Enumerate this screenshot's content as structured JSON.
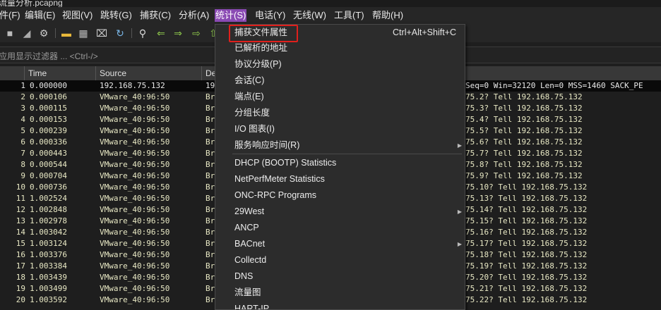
{
  "window": {
    "title": "流量分析.pcapng"
  },
  "menubar": {
    "items": [
      {
        "label": "件(F)",
        "name": "menu-file"
      },
      {
        "label": "编辑(E)",
        "name": "menu-edit"
      },
      {
        "label": "视图(V)",
        "name": "menu-view"
      },
      {
        "label": "跳转(G)",
        "name": "menu-go"
      },
      {
        "label": "捕获(C)",
        "name": "menu-capture"
      },
      {
        "label": "分析(A)",
        "name": "menu-analyze"
      },
      {
        "label": "统计(S)",
        "name": "menu-statistics",
        "active": true
      },
      {
        "label": "电话(Y)",
        "name": "menu-telephony"
      },
      {
        "label": "无线(W)",
        "name": "menu-wireless"
      },
      {
        "label": "工具(T)",
        "name": "menu-tools"
      },
      {
        "label": "帮助(H)",
        "name": "menu-help"
      }
    ]
  },
  "toolbar": {
    "icons": [
      "stop-capture-icon",
      "shark-fin-icon",
      "options-gear-icon",
      "open-folder-icon",
      "save-file-icon",
      "close-file-icon",
      "reload-icon",
      "find-packet-icon",
      "go-back-icon",
      "go-forward-icon",
      "go-to-packet-icon"
    ]
  },
  "filter": {
    "placeholder": "应用显示过滤器 ... <Ctrl-/>"
  },
  "columns": [
    "Time",
    "Source",
    "De"
  ],
  "packets": [
    {
      "no": "1",
      "time": "0.000000",
      "src": "192.168.75.132",
      "dst": "19",
      "info": "Seq=0 Win=32120 Len=0 MSS=1460 SACK_PE"
    },
    {
      "no": "2",
      "time": "0.000106",
      "src": "VMware_40:96:50",
      "dst": "Br",
      "info": "75.2? Tell 192.168.75.132"
    },
    {
      "no": "3",
      "time": "0.000115",
      "src": "VMware_40:96:50",
      "dst": "Br",
      "info": "75.3? Tell 192.168.75.132"
    },
    {
      "no": "4",
      "time": "0.000153",
      "src": "VMware_40:96:50",
      "dst": "Br",
      "info": "75.4? Tell 192.168.75.132"
    },
    {
      "no": "5",
      "time": "0.000239",
      "src": "VMware_40:96:50",
      "dst": "Br",
      "info": "75.5? Tell 192.168.75.132"
    },
    {
      "no": "6",
      "time": "0.000336",
      "src": "VMware_40:96:50",
      "dst": "Br",
      "info": "75.6? Tell 192.168.75.132"
    },
    {
      "no": "7",
      "time": "0.000443",
      "src": "VMware_40:96:50",
      "dst": "Br",
      "info": "75.7? Tell 192.168.75.132"
    },
    {
      "no": "8",
      "time": "0.000544",
      "src": "VMware_40:96:50",
      "dst": "Br",
      "info": "75.8? Tell 192.168.75.132"
    },
    {
      "no": "9",
      "time": "0.000704",
      "src": "VMware_40:96:50",
      "dst": "Br",
      "info": "75.9? Tell 192.168.75.132"
    },
    {
      "no": "10",
      "time": "0.000736",
      "src": "VMware_40:96:50",
      "dst": "Br",
      "info": "75.10? Tell 192.168.75.132"
    },
    {
      "no": "11",
      "time": "1.002524",
      "src": "VMware_40:96:50",
      "dst": "Br",
      "info": "75.13? Tell 192.168.75.132"
    },
    {
      "no": "12",
      "time": "1.002848",
      "src": "VMware_40:96:50",
      "dst": "Br",
      "info": "75.14? Tell 192.168.75.132"
    },
    {
      "no": "13",
      "time": "1.002978",
      "src": "VMware_40:96:50",
      "dst": "Br",
      "info": "75.15? Tell 192.168.75.132"
    },
    {
      "no": "14",
      "time": "1.003042",
      "src": "VMware_40:96:50",
      "dst": "Br",
      "info": "75.16? Tell 192.168.75.132"
    },
    {
      "no": "15",
      "time": "1.003124",
      "src": "VMware_40:96:50",
      "dst": "Br",
      "info": "75.17? Tell 192.168.75.132"
    },
    {
      "no": "16",
      "time": "1.003376",
      "src": "VMware_40:96:50",
      "dst": "Br",
      "info": "75.18? Tell 192.168.75.132"
    },
    {
      "no": "17",
      "time": "1.003384",
      "src": "VMware_40:96:50",
      "dst": "Br",
      "info": "75.19? Tell 192.168.75.132"
    },
    {
      "no": "18",
      "time": "1.003439",
      "src": "VMware_40:96:50",
      "dst": "Br",
      "info": "75.20? Tell 192.168.75.132"
    },
    {
      "no": "19",
      "time": "1.003499",
      "src": "VMware_40:96:50",
      "dst": "Br",
      "info": "75.21? Tell 192.168.75.132"
    },
    {
      "no": "20",
      "time": "1.003592",
      "src": "VMware_40:96:50",
      "dst": "Br",
      "info": "75.22? Tell 192.168.75.132"
    }
  ],
  "statistics_menu": {
    "items": [
      {
        "label": "捕获文件属性",
        "shortcut": "Ctrl+Alt+Shift+C",
        "name": "stats-capture-file-properties",
        "highlighted": true
      },
      {
        "label": "已解析的地址",
        "name": "stats-resolved-addresses"
      },
      {
        "label": "协议分级(P)",
        "name": "stats-protocol-hierarchy"
      },
      {
        "label": "会话(C)",
        "name": "stats-conversations"
      },
      {
        "label": "端点(E)",
        "name": "stats-endpoints"
      },
      {
        "label": "分组长度",
        "name": "stats-packet-lengths"
      },
      {
        "label": "I/O 图表(I)",
        "name": "stats-io-graph"
      },
      {
        "label": "服务响应时间(R)",
        "name": "stats-service-response-time",
        "submenu": true
      },
      {
        "label": "DHCP (BOOTP) Statistics",
        "name": "stats-dhcp",
        "sep_before": true
      },
      {
        "label": "NetPerfMeter Statistics",
        "name": "stats-netperfmeter"
      },
      {
        "label": "ONC-RPC Programs",
        "name": "stats-onc-rpc"
      },
      {
        "label": "29West",
        "name": "stats-29west",
        "submenu": true
      },
      {
        "label": "ANCP",
        "name": "stats-ancp"
      },
      {
        "label": "BACnet",
        "name": "stats-bacnet",
        "submenu": true
      },
      {
        "label": "Collectd",
        "name": "stats-collectd"
      },
      {
        "label": "DNS",
        "name": "stats-dns"
      },
      {
        "label": "流量图",
        "name": "stats-flow-graph"
      },
      {
        "label": "HART-IP",
        "name": "stats-hart-ip"
      }
    ]
  },
  "colors": {
    "accent_menu": "#8a4ab3",
    "highlight_box": "#e0201c",
    "row_text": "#e8e8c4"
  }
}
